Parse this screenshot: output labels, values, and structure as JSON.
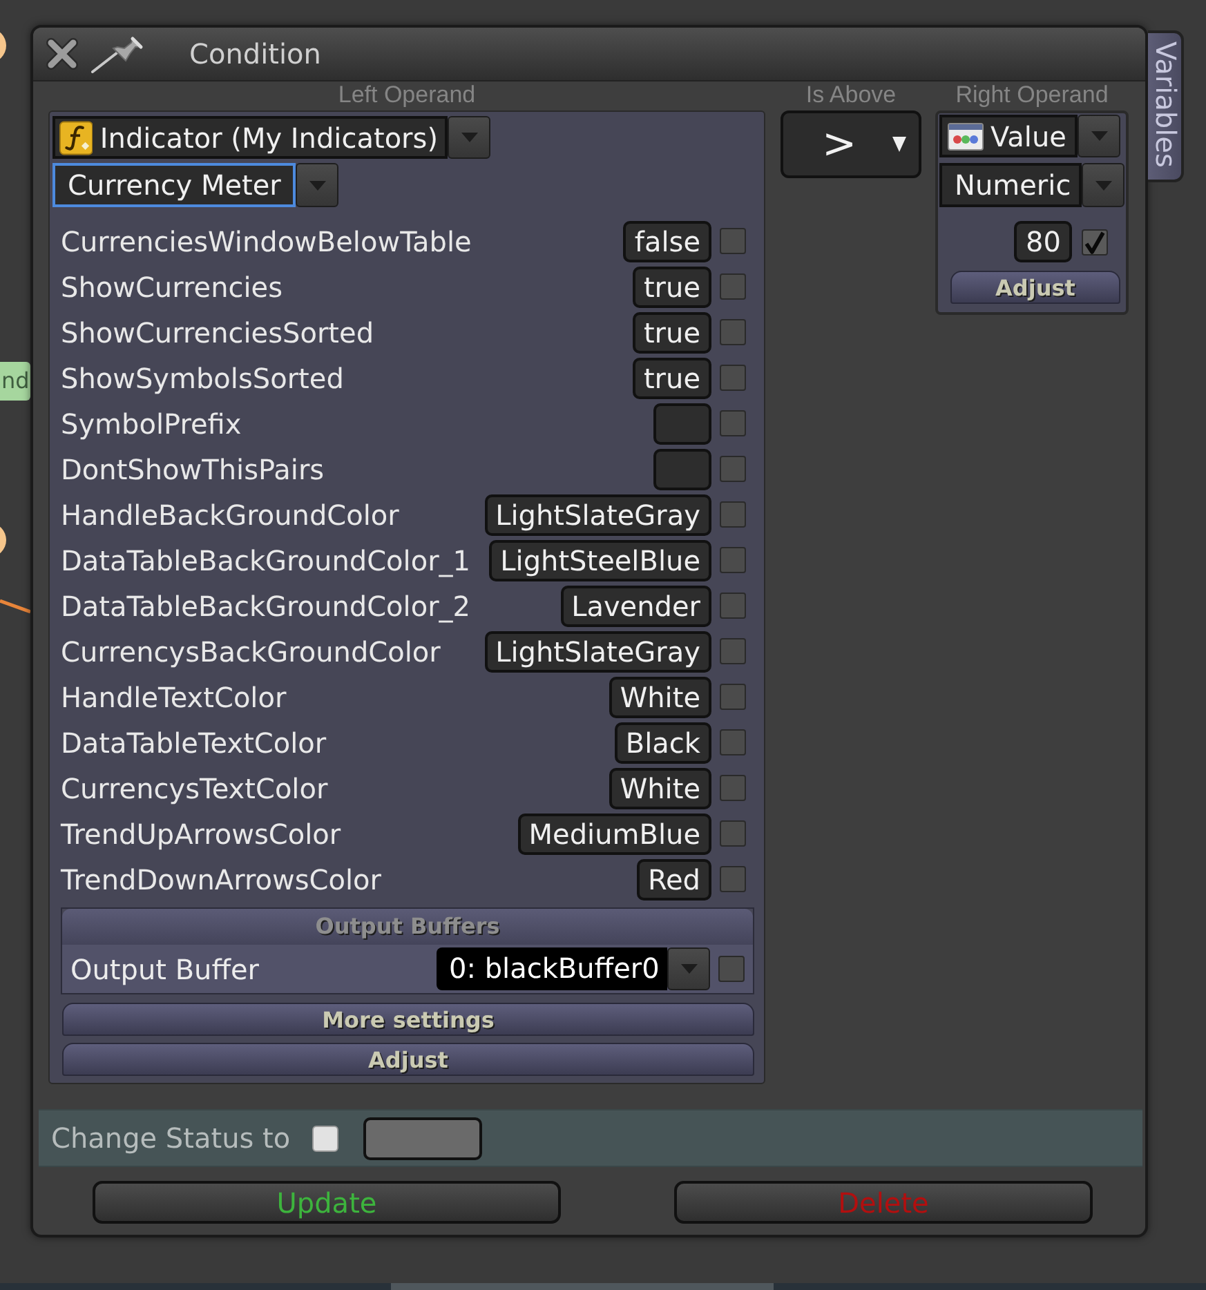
{
  "background": {
    "node_label": "nd"
  },
  "window": {
    "title": "Condition",
    "side_tab": "Variables"
  },
  "left_operand": {
    "label": "Left Operand",
    "source": "Indicator (My Indicators)",
    "indicator": {
      "value": "Currency Meter",
      "focused": true
    },
    "parameters": [
      {
        "name": "CurrenciesWindowBelowTable",
        "value": "false",
        "checked": false
      },
      {
        "name": "ShowCurrencies",
        "value": "true",
        "checked": false
      },
      {
        "name": "ShowCurrenciesSorted",
        "value": "true",
        "checked": false
      },
      {
        "name": "ShowSymbolsSorted",
        "value": "true",
        "checked": false
      },
      {
        "name": "SymbolPrefix",
        "checked": false
      },
      {
        "name": "DontShowThisPairs",
        "checked": false
      },
      {
        "name": "HandleBackGroundColor",
        "value": "LightSlateGray",
        "checked": false
      },
      {
        "name": "DataTableBackGroundColor_1",
        "value": "LightSteelBlue",
        "checked": false
      },
      {
        "name": "DataTableBackGroundColor_2",
        "value": "Lavender",
        "checked": false
      },
      {
        "name": "CurrencysBackGroundColor",
        "value": "LightSlateGray",
        "checked": false
      },
      {
        "name": "HandleTextColor",
        "value": "White",
        "checked": false
      },
      {
        "name": "DataTableTextColor",
        "value": "Black",
        "checked": false
      },
      {
        "name": "CurrencysTextColor",
        "value": "White",
        "checked": false
      },
      {
        "name": "TrendUpArrowsColor",
        "value": "MediumBlue",
        "checked": false
      },
      {
        "name": "TrendDownArrowsColor",
        "value": "Red",
        "checked": false
      }
    ],
    "output_buffers": {
      "title": "Output Buffers",
      "label": "Output Buffer",
      "value": "0: blackBuffer0",
      "checked": false
    },
    "buttons": [
      "More settings",
      "Adjust"
    ]
  },
  "operator": {
    "label": "Is Above",
    "value": ">"
  },
  "right_operand": {
    "label": "Right Operand",
    "source": "Value",
    "type": "Numeric",
    "number": {
      "value": "80",
      "checked": true
    },
    "button": "Adjust"
  },
  "change_status": {
    "label": "Change Status to",
    "checked": false
  },
  "actions": [
    {
      "label": "Update",
      "kind": "update"
    },
    {
      "label": "Delete",
      "kind": "delete"
    }
  ]
}
